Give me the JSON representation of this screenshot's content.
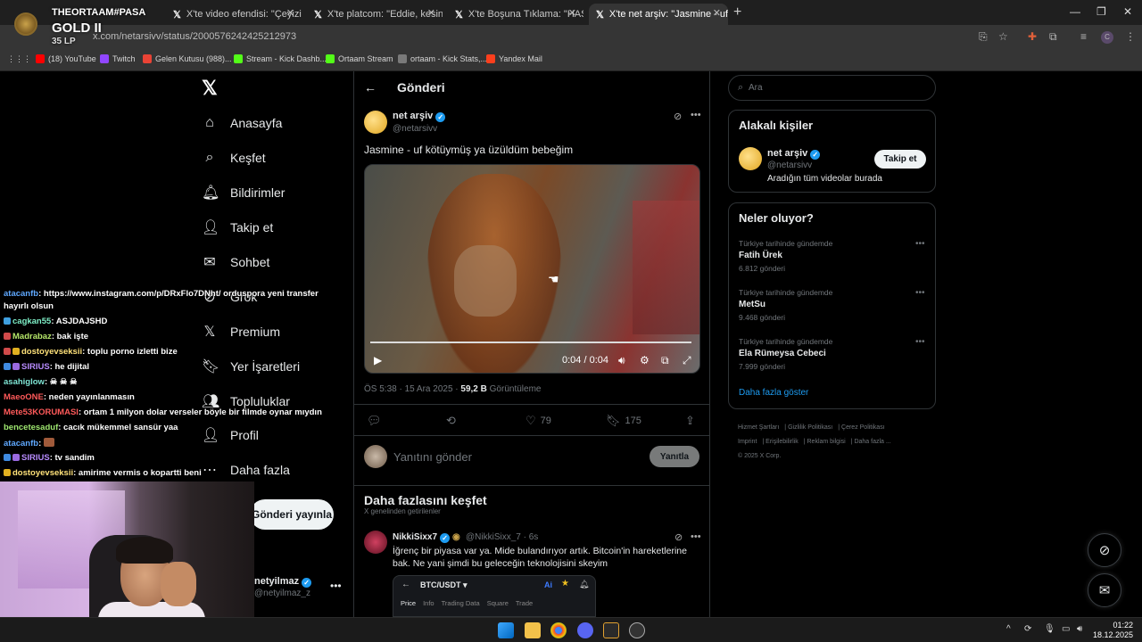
{
  "browser": {
    "tabs": [
      {
        "label": "X'te video efendisi: \"Çeyizinin o"
      },
      {
        "label": "X'te platcom: \"Eddie, kesin bir"
      },
      {
        "label": "X'te Boşuna Tıklama: \"HASSAS"
      },
      {
        "label": "X'te net arşiv: \"Jasmine - uf köt"
      }
    ],
    "url": "x.com/netarsivv/status/2000576242425212973",
    "bookmarks": [
      "(18) YouTube",
      "Twitch",
      "Gelen Kutusu (988)...",
      "Stream - Kick Dashb...",
      "Ortaam Stream",
      "ortaam - Kick Stats,...",
      "Yandex Mail"
    ],
    "stream_overlay": {
      "name": "THEORTAAM#PASA",
      "tier": "GOLD II",
      "lp": "35 LP"
    }
  },
  "nav": {
    "items": [
      "Anasayfa",
      "Keşfet",
      "Bildirimler",
      "Takip et",
      "Sohbet",
      "Grok",
      "Premium",
      "Yer İşaretleri",
      "Topluluklar",
      "Profil",
      "Daha fazla"
    ],
    "post_button": "Gönderi yayınla",
    "account_name": "netyilmaz",
    "account_handle": "@netyilmaz_z"
  },
  "post": {
    "header": "Gönderi",
    "author_name": "net arşiv",
    "author_handle": "@netarsivv",
    "text": "Jasmine - uf kötüymüş ya üzüldüm bebeğim",
    "video_time": "0:04 / 0:04",
    "video_progress": 1.0,
    "time": "ÖS 5:38 · 15 Ara 2025 ·",
    "views": "59,2 B",
    "views_label": "Görüntüleme",
    "likes": "79",
    "bookmarks": "175",
    "reply_placeholder": "Yanıtını gönder",
    "reply_button": "Yanıtla"
  },
  "explore": {
    "title": "Daha fazlasını keşfet",
    "subtitle": "X genelinden getirilenler",
    "item": {
      "name": "NikkiSixx7",
      "handle": "@NikkiSixx_7 · 6s",
      "text": "İğrenç bir piyasa var ya. Mide bulandırıyor artık. Bitcoin'in hareketlerine bak. Ne yani şimdi bu geleceğin teknolojisini skeyim",
      "embed_pair": "BTC/USDT",
      "embed_tabs": [
        "Price",
        "Info",
        "Trading Data",
        "Square",
        "Trade"
      ]
    }
  },
  "sidebar": {
    "search_placeholder": "Ara",
    "related_title": "Alakalı kişiler",
    "related": {
      "name": "net arşiv",
      "handle": "@netarsivv",
      "bio": "Aradığın tüm videolar burada",
      "follow": "Takip et"
    },
    "trends_title": "Neler oluyor?",
    "trends": [
      {
        "context": "Türkiye tarihinde gündemde",
        "name": "Fatih Ürek",
        "count": "6.812 gönderi"
      },
      {
        "context": "Türkiye tarihinde gündemde",
        "name": "MetSu",
        "count": "9.468 gönderi"
      },
      {
        "context": "Türkiye tarihinde gündemde",
        "name": "Ela Rümeysa Cebeci",
        "count": "7.999 gönderi"
      }
    ],
    "show_more": "Daha fazla göster",
    "footer": [
      "Hizmet Şartları",
      "Gizlilik Politikası",
      "Çerez Politikası",
      "Imprint",
      "Erişilebilirlik",
      "Reklam bilgisi",
      "Daha fazla ...",
      "© 2025 X Corp."
    ]
  },
  "chat": [
    {
      "user": "atacanfb",
      "color": "#5fa8ff",
      "msg": ": https://www.instagram.com/p/DRxFlo7DNht/ orduspora yeni transfer"
    },
    {
      "user": "",
      "color": "#fff",
      "msg": "hayırlı olsun"
    },
    {
      "user": "cagkan55",
      "color": "#7ff0c8",
      "msg": ": ASJDAJSHD"
    },
    {
      "user": "Madrabaz",
      "color": "#b7e86a",
      "msg": ": bak işte"
    },
    {
      "user": "dostoyevseksii",
      "color": "#ffe27a",
      "msg": ": toplu porno izletti bize"
    },
    {
      "user": "SIRIUS",
      "color": "#b88cff",
      "msg": ": he dijital"
    },
    {
      "user": "asahiglow",
      "color": "#7fe6d5",
      "msg": ": ☠ ☠ ☠"
    },
    {
      "user": "MaeoONE",
      "color": "#ff5a5a",
      "msg": ": neden yayınlanmasın"
    },
    {
      "user": "Mete53KORUMASI",
      "color": "#ff5a5a",
      "msg": ": ortam 1 milyon dolar verseler böyle bir filmde oynar mıydın"
    },
    {
      "user": "bencetesaduf",
      "color": "#9fe870",
      "msg": ": cacık mükemmel sansür yaa"
    },
    {
      "user": "atacanfb",
      "color": "#5fa8ff",
      "msg": ":"
    },
    {
      "user": "SIRIUS",
      "color": "#b88cff",
      "msg": ": tv sandim"
    },
    {
      "user": "dostoyevseksii",
      "color": "#ffe27a",
      "msg": ": amirime vermis o kopartti beni"
    }
  ],
  "taskbar": {
    "time": "01:22",
    "date": "18.12.2025"
  }
}
